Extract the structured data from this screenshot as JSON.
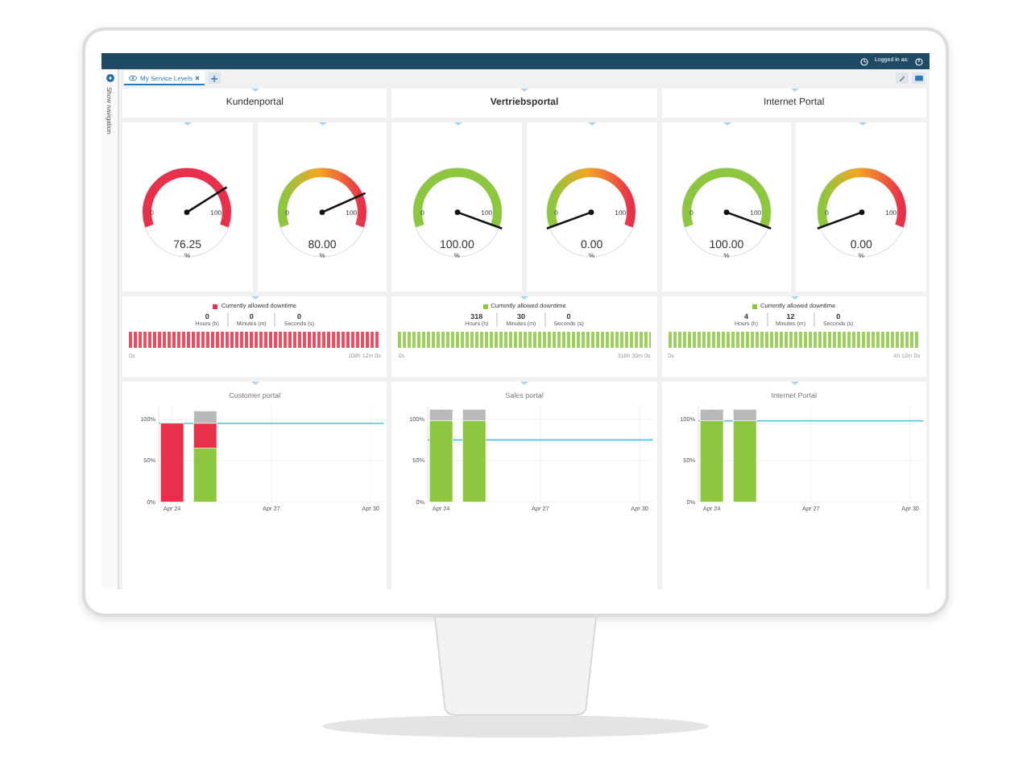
{
  "topbar": {
    "user_label": "Logged in as:"
  },
  "sidebar": {
    "label": "Show navigation"
  },
  "tabs": [
    {
      "label": "My Service Levels",
      "selected": true
    }
  ],
  "portals": [
    {
      "title": "Kundenportal",
      "highlighted": false,
      "gauges": [
        {
          "kind": "red",
          "min": "0",
          "max": "100",
          "value": "76.25",
          "unit": "%"
        },
        {
          "kind": "gradient",
          "min": "0",
          "max": "100",
          "value": "80.00",
          "unit": "%"
        }
      ],
      "downtime": {
        "legend": "Currently allowed downtime",
        "color": "#e8304a",
        "stats": [
          {
            "value": "0",
            "label": "Hours (h)"
          },
          {
            "value": "0",
            "label": "Minutes (m)"
          },
          {
            "value": "0",
            "label": "Seconds (s)"
          }
        ],
        "start": "0s",
        "end": "108h 12m 0s"
      },
      "chart_data": {
        "type": "bar",
        "title": "Customer portal",
        "categories": [
          "Apr 24",
          null,
          null,
          "Apr 27",
          null,
          null,
          "Apr 30"
        ],
        "stacked": true,
        "grid": true,
        "ylim": [
          0,
          115
        ],
        "series": [
          {
            "color": "#8dc63f",
            "values": [
              0,
              65,
              null,
              null,
              null,
              null,
              null
            ]
          },
          {
            "color": "#e8304a",
            "values": [
              95,
              30,
              null,
              null,
              null,
              null,
              null
            ]
          },
          {
            "color": "#b9b9b9",
            "values": [
              0,
              15,
              null,
              null,
              null,
              null,
              null
            ]
          }
        ],
        "yticks": [
          {
            "value": 0,
            "label": "0%"
          },
          {
            "value": 50,
            "label": "50%"
          },
          {
            "value": 100,
            "label": "100%"
          }
        ],
        "ref_lines": [
          {
            "axis": "y",
            "value": 95,
            "color": "#4fc3e8"
          }
        ]
      }
    },
    {
      "title": "Vertriebsportal",
      "highlighted": true,
      "gauges": [
        {
          "kind": "green",
          "min": "0",
          "max": "100",
          "value": "100.00",
          "unit": "%"
        },
        {
          "kind": "gradient",
          "min": "0",
          "max": "100",
          "value": "0.00",
          "unit": "%"
        }
      ],
      "downtime": {
        "legend": "Currently allowed downtime",
        "color": "#8dc63f",
        "stats": [
          {
            "value": "318",
            "label": "Hours (h)"
          },
          {
            "value": "30",
            "label": "Minutes (m)"
          },
          {
            "value": "0",
            "label": "Seconds (s)"
          }
        ],
        "start": "0s",
        "end": "318h 30m 0s"
      },
      "chart_data": {
        "type": "bar",
        "title": "Sales portal",
        "categories": [
          "Apr 24",
          null,
          null,
          "Apr 27",
          null,
          null,
          "Apr 30"
        ],
        "stacked": true,
        "grid": true,
        "ylim": [
          0,
          115
        ],
        "series": [
          {
            "color": "#8dc63f",
            "values": [
              98,
              98,
              null,
              null,
              null,
              null,
              null
            ]
          },
          {
            "color": "#b9b9b9",
            "values": [
              14,
              14,
              null,
              null,
              null,
              null,
              null
            ]
          }
        ],
        "yticks": [
          {
            "value": 0,
            "label": "0%"
          },
          {
            "value": 50,
            "label": "50%"
          },
          {
            "value": 100,
            "label": "100%"
          }
        ],
        "ref_lines": [
          {
            "axis": "y",
            "value": 75,
            "color": "#4fc3e8"
          }
        ]
      }
    },
    {
      "title": "Internet Portal",
      "highlighted": false,
      "gauges": [
        {
          "kind": "green",
          "min": "0",
          "max": "100",
          "value": "100.00",
          "unit": "%"
        },
        {
          "kind": "gradient",
          "min": "0",
          "max": "100",
          "value": "0.00",
          "unit": "%"
        }
      ],
      "downtime": {
        "legend": "Currently allowed downtime",
        "color": "#8dc63f",
        "stats": [
          {
            "value": "4",
            "label": "Hours (h)"
          },
          {
            "value": "12",
            "label": "Minutes (m)"
          },
          {
            "value": "0",
            "label": "Seconds (s)"
          }
        ],
        "start": "0s",
        "end": "4h 12m 0s"
      },
      "chart_data": {
        "type": "bar",
        "title": "Internet Portal",
        "categories": [
          "Apr 24",
          null,
          null,
          "Apr 27",
          null,
          null,
          "Apr 30"
        ],
        "stacked": true,
        "grid": true,
        "ylim": [
          0,
          115
        ],
        "series": [
          {
            "color": "#8dc63f",
            "values": [
              98,
              98,
              null,
              null,
              null,
              null,
              null
            ]
          },
          {
            "color": "#b9b9b9",
            "values": [
              14,
              14,
              null,
              null,
              null,
              null,
              null
            ]
          }
        ],
        "yticks": [
          {
            "value": 0,
            "label": "0%"
          },
          {
            "value": 50,
            "label": "50%"
          },
          {
            "value": 100,
            "label": "100%"
          }
        ],
        "ref_lines": [
          {
            "axis": "y",
            "value": 98,
            "color": "#4fc3e8"
          }
        ]
      }
    }
  ]
}
